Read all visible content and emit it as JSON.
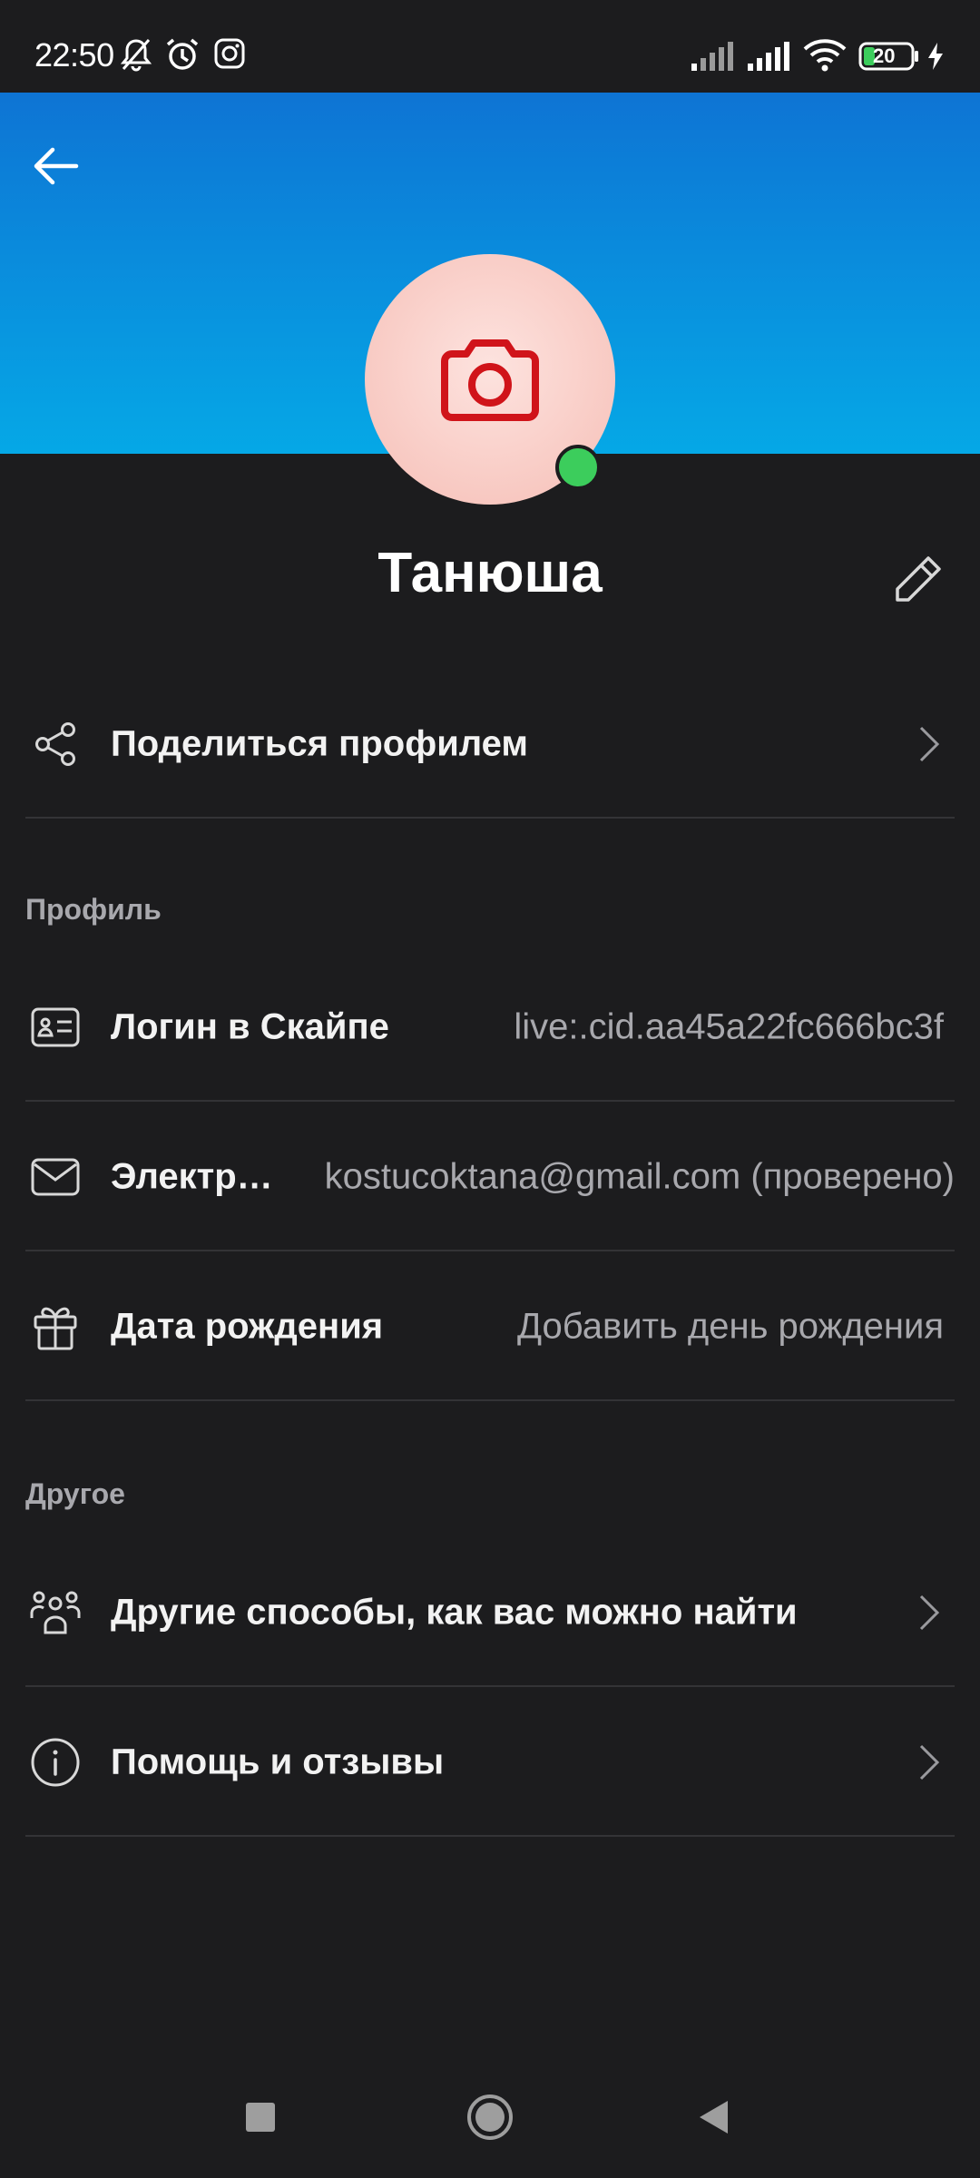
{
  "status_bar": {
    "time": "22:50",
    "battery_level": "20",
    "icons": [
      "bell-muted-icon",
      "alarm-icon",
      "instagram-icon",
      "signal-bars-icon",
      "signal-bars-icon",
      "wifi-icon",
      "battery-icon",
      "charging-bolt-icon"
    ]
  },
  "theme": {
    "banner_gradient_top": "#0e74d4",
    "banner_gradient_bottom": "#05a8e6",
    "background": "#1c1c1e",
    "avatar_camera_color": "#d0141a",
    "presence_color": "#3ccd5c"
  },
  "header": {
    "back_icon": "arrow-left-icon",
    "avatar_icon": "camera-icon"
  },
  "profile": {
    "name": "Танюша",
    "edit_icon": "pencil-icon"
  },
  "share_row": {
    "label": "Поделиться профилем",
    "icon": "share-icon"
  },
  "sections": {
    "profile_title": "Профиль",
    "other_title": "Другое"
  },
  "profile_rows": [
    {
      "label": "Логин в Скайпе",
      "value": "live:.cid.aa45a22fc666bc3f",
      "icon": "id-card-icon"
    },
    {
      "label": "Электр…",
      "value": "kostucoktana@gmail.com (проверено)",
      "icon": "envelope-icon"
    },
    {
      "label": "Дата рождения",
      "value": "Добавить день рождения",
      "icon": "gift-icon"
    }
  ],
  "other_rows": [
    {
      "label": "Другие способы, как вас можно найти",
      "icon": "people-group-icon"
    },
    {
      "label": "Помощь и отзывы",
      "icon": "info-icon"
    }
  ],
  "nav_bar": {
    "icons": [
      "recents-square-icon",
      "home-circle-icon",
      "back-triangle-icon"
    ]
  }
}
